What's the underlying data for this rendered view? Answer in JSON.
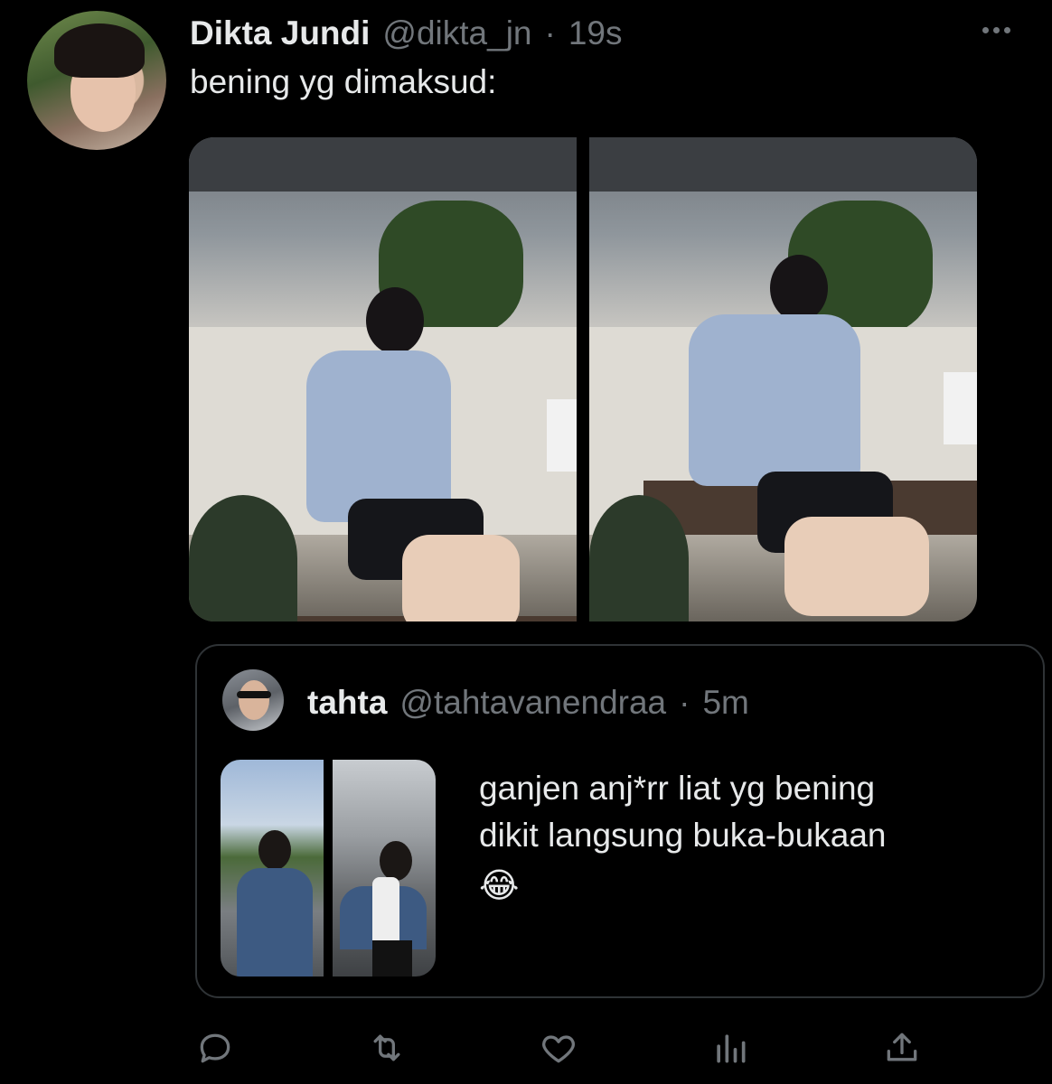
{
  "tweet": {
    "display_name": "Dikta Jundi",
    "handle": "@dikta_jn",
    "separator": "·",
    "time": "19s",
    "text": "bening yg dimaksud:",
    "more_icon": "more-horizontal-icon",
    "media_count": 2
  },
  "quoted_tweet": {
    "display_name": "tahta",
    "handle": "@tahtavanendraa",
    "separator": "·",
    "time": "5m",
    "text_line1": "ganjen anj*rr liat yg bening",
    "text_line2": "dikit langsung buka-bukaan",
    "emoji": "😂",
    "media_count": 2
  },
  "actions": [
    {
      "name": "reply",
      "icon": "reply-icon"
    },
    {
      "name": "retweet",
      "icon": "retweet-icon"
    },
    {
      "name": "like",
      "icon": "heart-icon"
    },
    {
      "name": "analytics",
      "icon": "analytics-icon"
    },
    {
      "name": "share",
      "icon": "share-icon"
    }
  ],
  "colors": {
    "background": "#000000",
    "text_primary": "#e7e9ea",
    "text_secondary": "#71767b",
    "border": "#2f3336"
  }
}
